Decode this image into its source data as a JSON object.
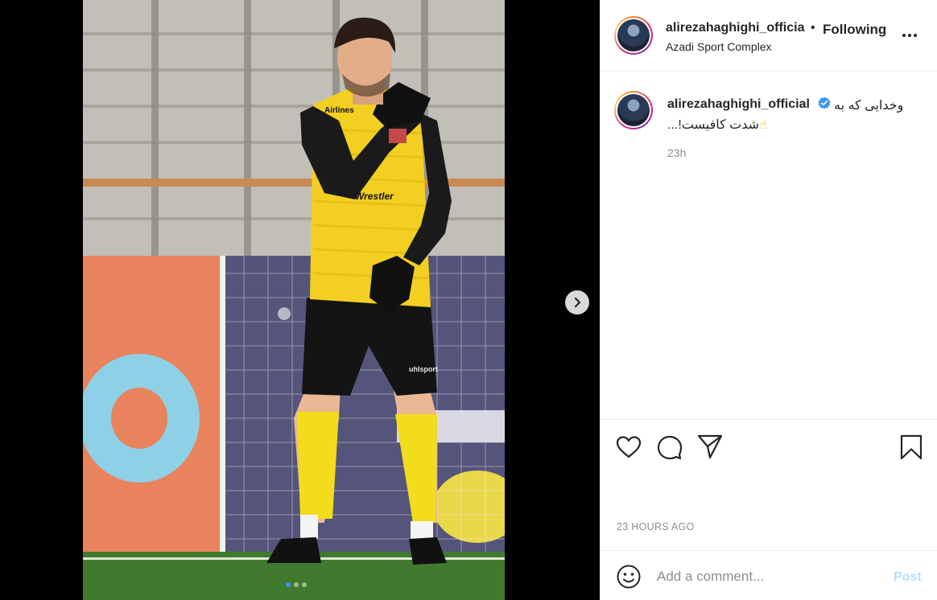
{
  "post": {
    "username": "alirezahaghighi_officia",
    "separator": "•",
    "follow_status": "Following",
    "location": "Azadi Sport Complex"
  },
  "caption": {
    "username": "alirezahaghighi_official",
    "text_line1": "وخدایی که به",
    "text_line2": "...!شدت کافیست",
    "emoji": "☝",
    "time": "23h"
  },
  "media": {
    "carousel_count": 3,
    "carousel_active": 0,
    "shirt_sponsor": "Airlines",
    "shirt_brand": "Wrestler",
    "shorts_brand": "uhlsport"
  },
  "meta": {
    "timestamp": "23 HOURS AGO"
  },
  "comment_box": {
    "placeholder": "Add a comment...",
    "post_label": "Post"
  },
  "icons": {
    "more": "more-horizontal-icon",
    "verified": "verified-badge-icon",
    "like": "heart-icon",
    "comment": "comment-bubble-icon",
    "share": "paper-plane-icon",
    "save": "bookmark-icon",
    "emoji": "smiley-icon",
    "next": "chevron-right-icon"
  },
  "colors": {
    "verified_blue": "#3897f0",
    "active_dot": "#3897f0",
    "post_button_disabled": "#b2dffc",
    "secondary_text": "#8e8e8e",
    "jersey_yellow": "#f2cf21"
  }
}
